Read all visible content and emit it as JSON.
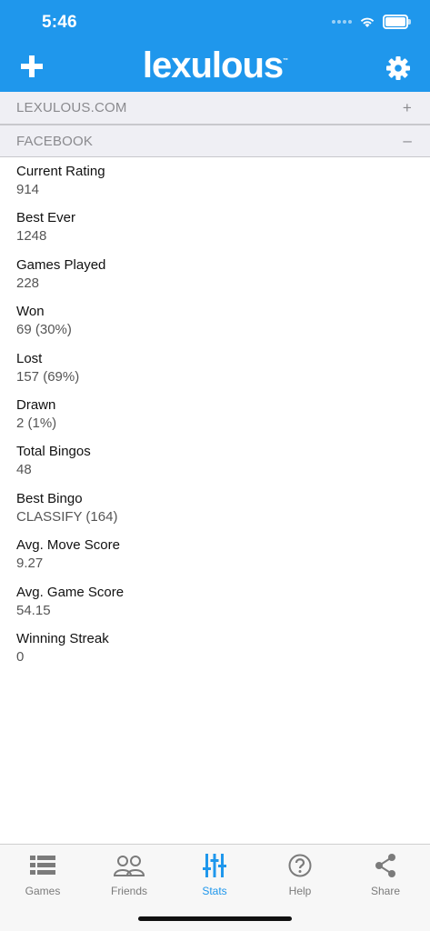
{
  "status_bar": {
    "time": "5:46"
  },
  "header": {
    "logo": "lexulous",
    "trademark": "™",
    "add_icon": "plus-icon",
    "settings_icon": "gear-icon"
  },
  "sections": [
    {
      "title": "LEXULOUS.COM",
      "toggle": "+"
    },
    {
      "title": "FACEBOOK",
      "toggle": "–"
    }
  ],
  "stats": [
    {
      "label": "Current Rating",
      "value": "914"
    },
    {
      "label": "Best Ever",
      "value": "1248"
    },
    {
      "label": "Games Played",
      "value": "228"
    },
    {
      "label": "Won",
      "value": "69 (30%)"
    },
    {
      "label": "Lost",
      "value": "157 (69%)"
    },
    {
      "label": "Drawn",
      "value": "2 (1%)"
    },
    {
      "label": "Total Bingos",
      "value": "48"
    },
    {
      "label": "Best Bingo",
      "value": "CLASSIFY (164)"
    },
    {
      "label": "Avg. Move Score",
      "value": "9.27"
    },
    {
      "label": "Avg. Game Score",
      "value": "54.15"
    },
    {
      "label": "Winning Streak",
      "value": "0"
    }
  ],
  "tabs": [
    {
      "label": "Games",
      "icon": "list-icon"
    },
    {
      "label": "Friends",
      "icon": "friends-icon"
    },
    {
      "label": "Stats",
      "icon": "sliders-icon"
    },
    {
      "label": "Help",
      "icon": "help-icon"
    },
    {
      "label": "Share",
      "icon": "share-icon"
    }
  ],
  "colors": {
    "accent": "#1f97ec",
    "tab_inactive": "#7b7b7b",
    "section_bg": "#efeff4"
  }
}
